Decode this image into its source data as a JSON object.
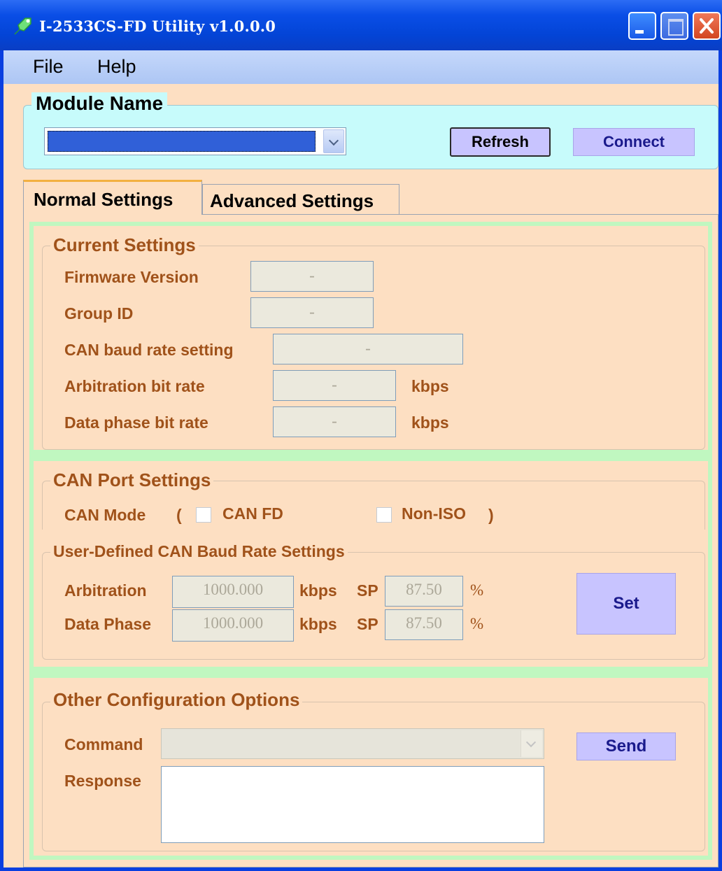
{
  "window": {
    "title": "I-2533CS-FD Utility v1.0.0.0"
  },
  "menu": {
    "file": "File",
    "help": "Help"
  },
  "module": {
    "legend": "Module Name",
    "selected_value": "",
    "refresh": "Refresh",
    "connect": "Connect"
  },
  "tabs": {
    "normal": "Normal Settings",
    "advanced": "Advanced Settings"
  },
  "current": {
    "legend": "Current Settings",
    "firmware_label": "Firmware Version",
    "firmware_value": "-",
    "group_label": "Group ID",
    "group_value": "-",
    "baud_label": "CAN baud rate setting",
    "baud_value": "-",
    "arb_label": "Arbitration bit rate",
    "arb_value": "-",
    "arb_unit": "kbps",
    "data_label": "Data phase bit rate",
    "data_value": "-",
    "data_unit": "kbps"
  },
  "port": {
    "legend": "CAN Port Settings",
    "mode_label": "CAN Mode",
    "paren_open": "(",
    "canfd_label": "CAN FD",
    "noniso_label": "Non-ISO",
    "paren_close": ")"
  },
  "user_baud": {
    "legend": "User-Defined CAN Baud Rate Settings",
    "arb_label": "Arbitration",
    "arb_value": "1000.000",
    "arb_unit": "kbps",
    "arb_sp_label": "SP",
    "arb_sp_value": "87.50",
    "arb_pct": "%",
    "data_label": "Data Phase",
    "data_value": "1000.000",
    "data_unit": "kbps",
    "data_sp_label": "SP",
    "data_sp_value": "87.50",
    "data_pct": "%",
    "set": "Set"
  },
  "other": {
    "legend": "Other Configuration Options",
    "command_label": "Command",
    "command_value": "",
    "send": "Send",
    "response_label": "Response",
    "response_value": ""
  }
}
